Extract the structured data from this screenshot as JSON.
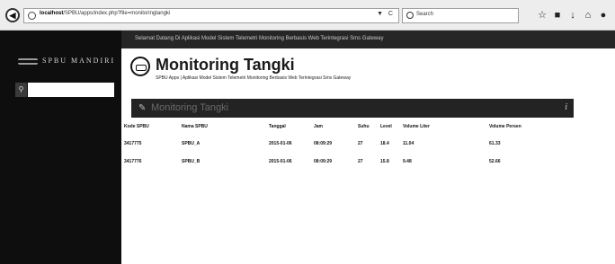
{
  "browser": {
    "url_host": "localhost",
    "url_path": "/SPBU/apps/index.php?file=monitoringtangki",
    "url_controls": "▼ C",
    "search_placeholder": "Search"
  },
  "sidebar": {
    "brand": "SPBU MANDIRI"
  },
  "topbar": {
    "text": "Selamat Datang Di Aplikasi Model Sistem Telemetri Monitoring Berbasis Web Terintegrasi Sms Gateway"
  },
  "page": {
    "title": "Monitoring Tangki",
    "subtitle": "SPBU Apps | Aplikasi Model Sistem Telemetri Monitoring Berbasis Web Terintegrasi Sms Gateway"
  },
  "panel": {
    "title": "Monitoring Tangki",
    "info_glyph": "i"
  },
  "table": {
    "headers": [
      "Kode SPBU",
      "Nama SPBU",
      "Tanggal",
      "Jam",
      "Suhu",
      "Level",
      "Volume Liter",
      "Volume Persen"
    ],
    "rows": [
      [
        "3417775",
        "SPBU_A",
        "2015-01-06",
        "08:09:29",
        "27",
        "18.4",
        "11.04",
        "61.33"
      ],
      [
        "3417776",
        "SPBU_B",
        "2015-01-06",
        "08:09:29",
        "27",
        "15.8",
        "9.48",
        "52.66"
      ]
    ]
  }
}
